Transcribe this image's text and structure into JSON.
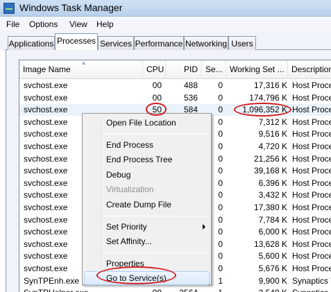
{
  "window": {
    "title": "Windows Task Manager",
    "icon": "task-manager-icon"
  },
  "menu": [
    "File",
    "Options",
    "View",
    "Help"
  ],
  "tabs": [
    {
      "label": "Applications",
      "active": false
    },
    {
      "label": "Processes",
      "active": true
    },
    {
      "label": "Services",
      "active": false
    },
    {
      "label": "Performance",
      "active": false
    },
    {
      "label": "Networking",
      "active": false
    },
    {
      "label": "Users",
      "active": false
    }
  ],
  "table": {
    "columns": [
      "Image Name",
      "CPU",
      "PID",
      "Se...",
      "Working Set ...",
      "Description"
    ],
    "sort_column": "Image Name",
    "rows": [
      {
        "name": "svchost.exe",
        "cpu": "00",
        "pid": "488",
        "session": "0",
        "ws": "17,316 K",
        "desc": "Host Process"
      },
      {
        "name": "svchost.exe",
        "cpu": "00",
        "pid": "536",
        "session": "0",
        "ws": "174,796 K",
        "desc": "Host Process"
      },
      {
        "name": "svchost.exe",
        "cpu": "50",
        "pid": "584",
        "session": "0",
        "ws": "1,096,352 K",
        "desc": "Host Process",
        "selected": true
      },
      {
        "name": "svchost.exe",
        "cpu": "",
        "pid": "",
        "session": "0",
        "ws": "7,312 K",
        "desc": "Host Process"
      },
      {
        "name": "svchost.exe",
        "cpu": "",
        "pid": "",
        "session": "0",
        "ws": "9,516 K",
        "desc": "Host Process"
      },
      {
        "name": "svchost.exe",
        "cpu": "",
        "pid": "",
        "session": "0",
        "ws": "4,720 K",
        "desc": "Host Process"
      },
      {
        "name": "svchost.exe",
        "cpu": "",
        "pid": "",
        "session": "0",
        "ws": "21,256 K",
        "desc": "Host Process"
      },
      {
        "name": "svchost.exe",
        "cpu": "",
        "pid": "",
        "session": "0",
        "ws": "39,168 K",
        "desc": "Host Process"
      },
      {
        "name": "svchost.exe",
        "cpu": "",
        "pid": "",
        "session": "0",
        "ws": "6,396 K",
        "desc": "Host Process"
      },
      {
        "name": "svchost.exe",
        "cpu": "",
        "pid": "",
        "session": "0",
        "ws": "3,432 K",
        "desc": "Host Process"
      },
      {
        "name": "svchost.exe",
        "cpu": "",
        "pid": "",
        "session": "0",
        "ws": "17,380 K",
        "desc": "Host Process"
      },
      {
        "name": "svchost.exe",
        "cpu": "",
        "pid": "",
        "session": "0",
        "ws": "7,784 K",
        "desc": "Host Process"
      },
      {
        "name": "svchost.exe",
        "cpu": "",
        "pid": "",
        "session": "0",
        "ws": "6,000 K",
        "desc": "Host Process"
      },
      {
        "name": "svchost.exe",
        "cpu": "",
        "pid": "",
        "session": "0",
        "ws": "13,628 K",
        "desc": "Host Process"
      },
      {
        "name": "svchost.exe",
        "cpu": "",
        "pid": "",
        "session": "0",
        "ws": "5,600 K",
        "desc": "Host Process"
      },
      {
        "name": "svchost.exe",
        "cpu": "",
        "pid": "",
        "session": "0",
        "ws": "5,676 K",
        "desc": "Host Process"
      },
      {
        "name": "SynTPEnh.exe",
        "cpu": "",
        "pid": "",
        "session": "1",
        "ws": "9,900 K",
        "desc": "Synaptics TouchPad"
      },
      {
        "name": "SynTPHelper.exe",
        "cpu": "00",
        "pid": "2564",
        "session": "1",
        "ws": "2,540 K",
        "desc": "Synaptics Pointing"
      }
    ]
  },
  "context_menu": {
    "items": [
      {
        "label": "Open File Location"
      },
      {
        "separator": true
      },
      {
        "label": "End Process"
      },
      {
        "label": "End Process Tree"
      },
      {
        "label": "Debug"
      },
      {
        "label": "Virtualization",
        "disabled": true
      },
      {
        "label": "Create Dump File"
      },
      {
        "separator": true
      },
      {
        "label": "Set Priority",
        "submenu": true
      },
      {
        "label": "Set Affinity..."
      },
      {
        "separator": true
      },
      {
        "label": "Properties"
      },
      {
        "label": "Go to Service(s)",
        "hover": true
      }
    ]
  },
  "colors": {
    "highlight_ring": "#d21f1f",
    "selected_row": "#eaf3fc",
    "menu_hover": "#dbeafb"
  }
}
